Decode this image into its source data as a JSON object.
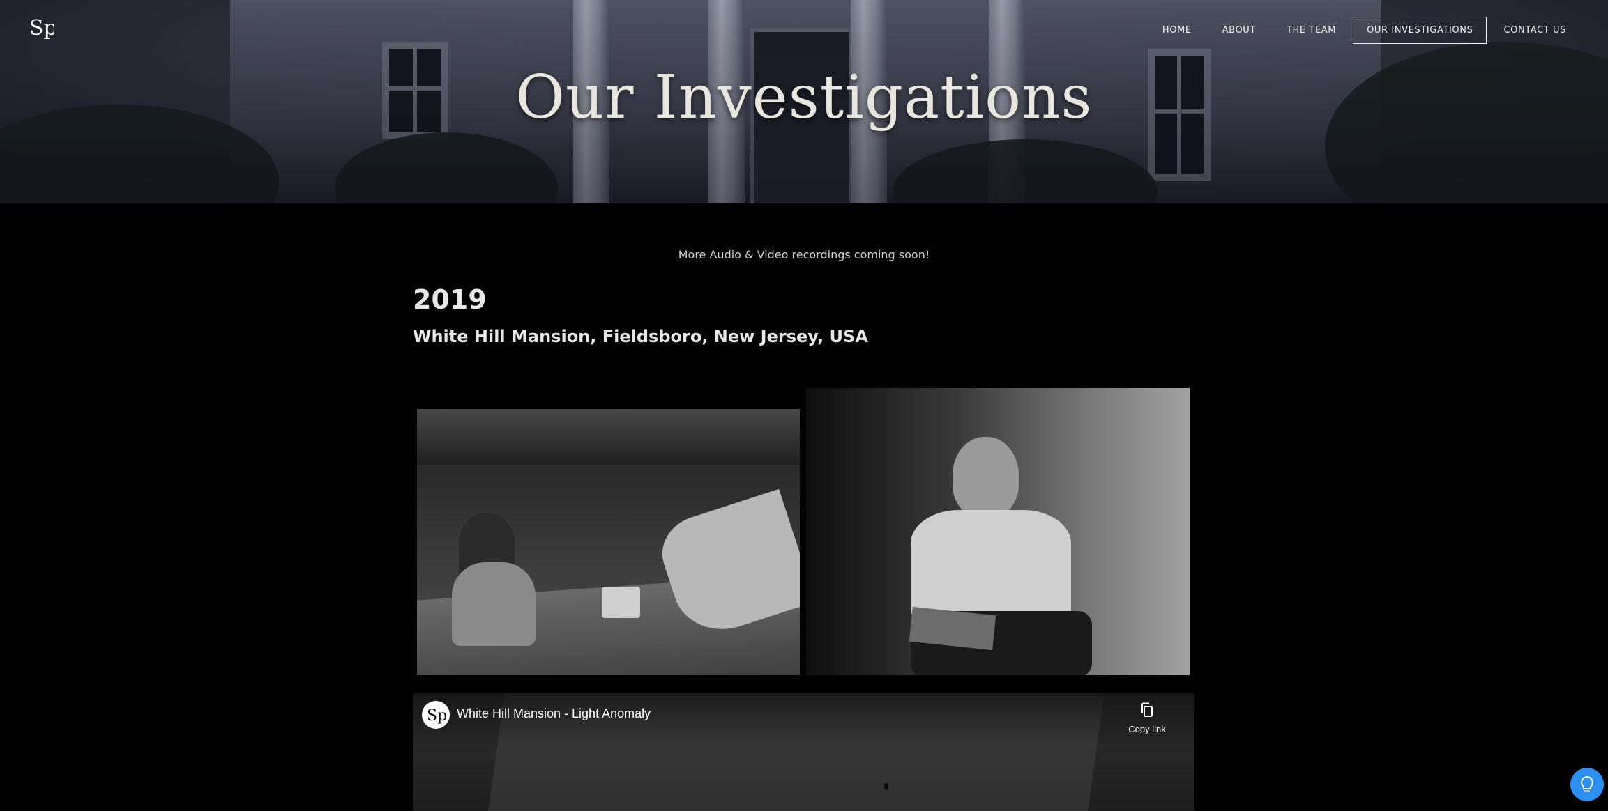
{
  "header": {
    "logo_text": "Sp",
    "hero_title": "Our Investigations",
    "nav": [
      {
        "label": "HOME",
        "active": false
      },
      {
        "label": "ABOUT",
        "active": false
      },
      {
        "label": "THE TEAM",
        "active": false
      },
      {
        "label": "OUR INVESTIGATIONS",
        "active": true
      },
      {
        "label": "CONTACT US",
        "active": false
      }
    ]
  },
  "main": {
    "notice": "More Audio & Video recordings coming soon!",
    "year": "2019",
    "location": "White Hill Mansion, Fieldsboro, New Jersey, USA",
    "video": {
      "title": "White Hill Mansion - Light Anomaly",
      "copy_link_label": "Copy link",
      "channel_logo_text": "Sp"
    }
  },
  "icons": {
    "copy": "copy-icon",
    "help": "lightbulb-icon"
  },
  "colors": {
    "background": "#000000",
    "text": "#e7e7e7",
    "help_button": "#2d8ff0"
  }
}
